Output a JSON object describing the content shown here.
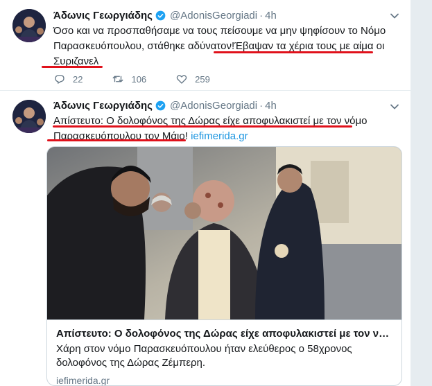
{
  "tweets": [
    {
      "author_name": "Άδωνις Γεωργιάδης",
      "author_handle": "@AdonisGeorgiadi",
      "separator": "·",
      "time": "4h",
      "text_line1": "Όσο και να προσπαθήσαμε να τους πείσουμε να μην ψηφίσουν το Νόμο",
      "text_line2": "Παρασκευόπουλου, στάθηκε αδύνατον!Έβαψαν τα χέρια τους με αίμα οι",
      "text_line3": "Συριζανελ",
      "replies": "22",
      "retweets": "106",
      "likes": "259"
    },
    {
      "author_name": "Άδωνις Γεωργιάδης",
      "author_handle": "@AdonisGeorgiadi",
      "separator": "·",
      "time": "4h",
      "text_line1": "Απίστευτο: Ο δολοφόνος της Δώρας είχε αποφυλακιστεί με τον νόμο",
      "text_line2": "Παρασκευόπουλου τον Μάιο! ",
      "text_link": "iefimerida.gr",
      "card": {
        "title": "Απίστευτο: Ο δολοφόνος της Δώρας είχε αποφυλακιστεί με τον νόμο...",
        "description": "Χάρη στον νόμο Παρασκευόπουλου ήταν ελεύθερος ο 58χρονος δολοφόνος της Δώρας Ζέμπερη.",
        "domain": "iefimerida.gr"
      }
    }
  ],
  "colors": {
    "link": "#1b95e0",
    "muted": "#657786",
    "verified": "#1da1f2",
    "highlight": "#e0111b",
    "divider": "#e6ecf0"
  },
  "icons": [
    "verified-badge-icon",
    "chevron-down-icon",
    "reply-icon",
    "retweet-icon",
    "like-icon"
  ]
}
